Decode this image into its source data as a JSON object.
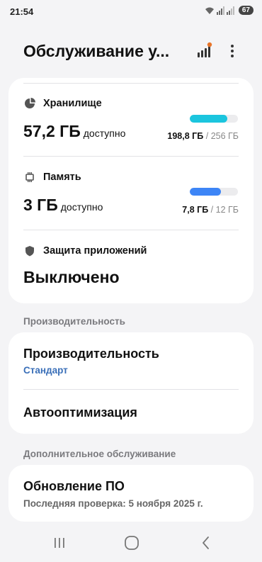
{
  "status_bar": {
    "time": "21:54",
    "battery": "67",
    "icons": [
      "wifi-icon",
      "signal-icon",
      "signal-icon"
    ]
  },
  "header": {
    "title": "Обслуживание у...",
    "actions": [
      "signal-bars-icon",
      "more-vertical-icon"
    ]
  },
  "storage": {
    "label": "Хранилище",
    "icon": "pie-chart-icon",
    "available_value": "57,2 ГБ",
    "available_label": "доступно",
    "used": "198,8 ГБ",
    "separator": "/",
    "total": "256 ГБ",
    "used_fraction": 0.78,
    "bar_color": "#1bc5de"
  },
  "memory": {
    "label": "Память",
    "icon": "memory-chip-icon",
    "available_value": "3 ГБ",
    "available_label": "доступно",
    "used": "7,8 ГБ",
    "separator": "/",
    "total": "12 ГБ",
    "used_fraction": 0.65,
    "bar_color": "#3d85f6"
  },
  "app_protection": {
    "label": "Защита приложений",
    "icon": "shield-icon",
    "status": "Выключено"
  },
  "performance_section": {
    "heading": "Производительность",
    "items": [
      {
        "title": "Производительность",
        "subtitle": "Стандарт"
      },
      {
        "title": "Автооптимизация"
      }
    ],
    "accent_color": "#3a6fb8"
  },
  "additional_section": {
    "heading": "Дополнительное обслуживание",
    "items": [
      {
        "title": "Обновление ПО",
        "subtitle": "Последняя проверка: 5 ноября 2025 г."
      }
    ]
  },
  "navbar": {
    "buttons": [
      "recents-icon",
      "home-icon",
      "back-icon"
    ]
  }
}
